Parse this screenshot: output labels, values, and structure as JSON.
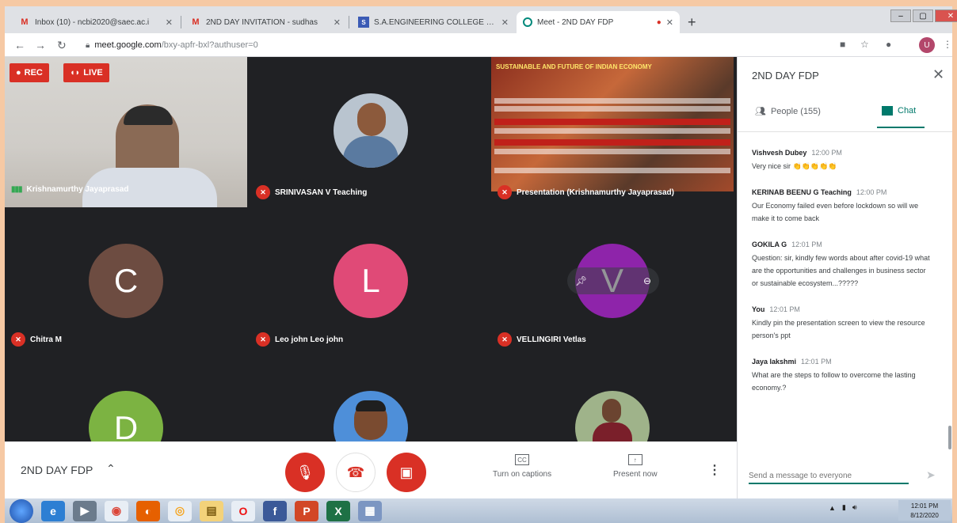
{
  "browser": {
    "tabs": [
      {
        "title": "Inbox (10) - ncbi2020@saec.ac.i",
        "favicon": "gmail-icon"
      },
      {
        "title": "2ND DAY INVITATION - sudhas",
        "favicon": "gmail-icon"
      },
      {
        "title": "S.A.ENGINEERING COLLEGE - Co",
        "favicon": "college-icon"
      },
      {
        "title": "Meet - 2ND DAY FDP",
        "favicon": "meet-icon",
        "active": true
      }
    ],
    "url_host": "meet.google.com",
    "url_path": "/bxy-apfr-bxl?authuser=0",
    "profile_initial": "U"
  },
  "meet": {
    "badges": {
      "rec": "REC",
      "live": "LIVE"
    },
    "participants": [
      {
        "name": "Krishnamurthy Jayaprasad",
        "type": "video",
        "speaking": true
      },
      {
        "name": "SRINIVASAN V Teaching",
        "type": "photo",
        "muted": true
      },
      {
        "name": "Presentation (Krishnamurthy Jayaprasad)",
        "type": "presentation",
        "muted": true
      },
      {
        "name": "Chitra M",
        "type": "initial",
        "initial": "C",
        "color": "#6d4c41",
        "muted": true
      },
      {
        "name": "Leo john Leo john",
        "type": "initial",
        "initial": "L",
        "color": "#e04a77",
        "muted": true
      },
      {
        "name": "VELLINGIRI Vetlas",
        "type": "initial",
        "initial": "V",
        "color": "#8e24aa",
        "muted": true
      },
      {
        "name": "",
        "type": "initial",
        "initial": "D",
        "color": "#7cb342"
      },
      {
        "name": "",
        "type": "photo"
      },
      {
        "name": "",
        "type": "photo"
      }
    ],
    "presentation_title": "SUSTAINABLE AND FUTURE OF INDIAN ECONOMY",
    "bottom": {
      "meeting_name": "2ND DAY FDP",
      "captions_label": "Turn on captions",
      "present_label": "Present now"
    }
  },
  "panel": {
    "title": "2ND DAY FDP",
    "people_tab": "People (155)",
    "chat_tab": "Chat",
    "messages": [
      {
        "sender": "Vishvesh Dubey",
        "time": "12:00 PM",
        "text": "Very nice sir 👏👏👏👏👏"
      },
      {
        "sender": "KERINAB BEENU G Teaching",
        "time": "12:00 PM",
        "text": "Our Economy failed even before lockdown so will we make it to come back"
      },
      {
        "sender": "GOKILA G",
        "time": "12:01 PM",
        "text": "Question: sir, kindly few words about after covid-19 what are the opportunities and challenges in business sector or sustainable ecosystem...?????"
      },
      {
        "sender": "You",
        "time": "12:01 PM",
        "text": "Kindly pin the presentation screen to view the resource person's ppt"
      },
      {
        "sender": "Jaya lakshmi",
        "time": "12:01 PM",
        "text": "What are the steps to follow to overcome the lasting economy.?"
      }
    ],
    "composer_placeholder": "Send a message to everyone"
  },
  "taskbar": {
    "clock_time": "12:01 PM",
    "clock_date": "8/12/2020"
  }
}
